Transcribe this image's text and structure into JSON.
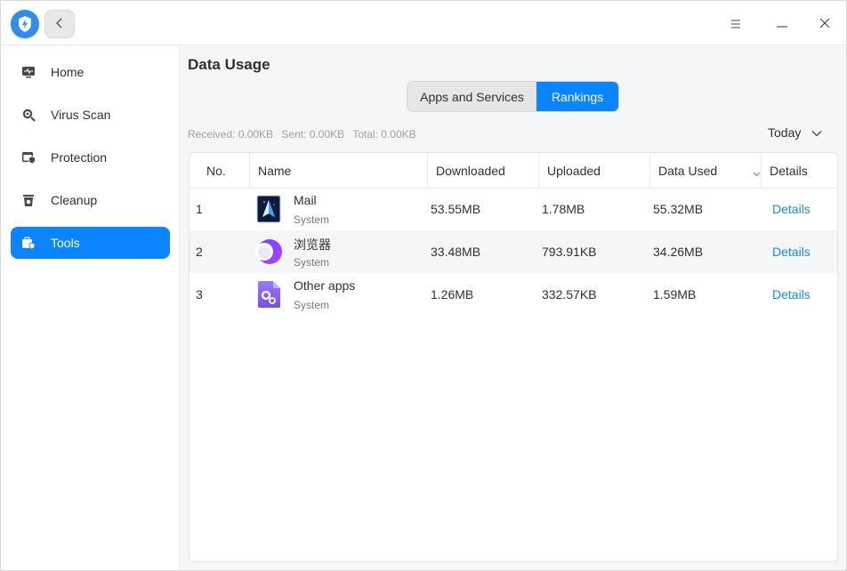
{
  "header": {
    "logo_icon": "shield-lightning-icon",
    "back_icon": "chevron-left-icon",
    "menu_icon": "hamburger-menu-icon",
    "minimize_icon": "minimize-icon",
    "close_icon": "close-icon"
  },
  "sidebar": {
    "items": [
      {
        "label": "Home",
        "icon": "monitor-pulse-icon"
      },
      {
        "label": "Virus Scan",
        "icon": "magnifier-scan-icon"
      },
      {
        "label": "Protection",
        "icon": "browser-shield-icon"
      },
      {
        "label": "Cleanup",
        "icon": "trash-can-icon"
      },
      {
        "label": "Tools",
        "icon": "toolbox-icon",
        "active": true
      }
    ]
  },
  "main": {
    "title": "Data Usage",
    "tabs": [
      {
        "label": "Apps and Services"
      },
      {
        "label": "Rankings",
        "selected": true
      }
    ],
    "summary": {
      "received": "Received: 0.00KB",
      "sent": "Sent: 0.00KB",
      "total": "Total: 0.00KB"
    },
    "period": {
      "selected": "Today"
    },
    "table": {
      "columns": [
        "No.",
        "Name",
        "Downloaded",
        "Uploaded",
        "Data Used",
        "Details"
      ],
      "rows": [
        {
          "no": "1",
          "name": "Mail",
          "sub": "System",
          "downloaded": "53.55MB",
          "uploaded": "1.78MB",
          "used": "55.32MB",
          "details": "Details",
          "icon": "mail-app-icon"
        },
        {
          "no": "2",
          "name": "浏览器",
          "sub": "System",
          "downloaded": "33.48MB",
          "uploaded": "793.91KB",
          "used": "34.26MB",
          "details": "Details",
          "icon": "browser-app-icon"
        },
        {
          "no": "3",
          "name": "Other apps",
          "sub": "System",
          "downloaded": "1.26MB",
          "uploaded": "332.57KB",
          "used": "1.59MB",
          "details": "Details",
          "icon": "other-apps-icon"
        }
      ]
    }
  },
  "colors": {
    "accent": "#0a84ff",
    "link": "#1a87e6",
    "background": "#f5f6f8"
  }
}
